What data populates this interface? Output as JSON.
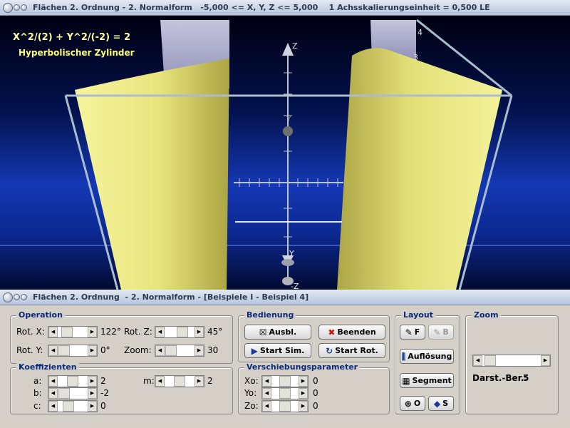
{
  "main_window": {
    "title": "Flächen 2. Ordnung - 2. Normalform   -5,000 <= X, Y, Z <= 5,000    1 Achsskalierungseinheit = 0,500 LE"
  },
  "scene": {
    "equation": "X^2/(2) + Y^2/(-2) = 2",
    "surface_name": "Hyperbolischer Zylinder",
    "axis_labels": {
      "z_top": "Z",
      "z_bottom": "-Z",
      "y_back": "Y",
      "y_front": "Y"
    },
    "corner_labels": {
      "four": "4",
      "three": "3"
    },
    "colors": {
      "surface": "#ecec7c",
      "background_dark": "#000012",
      "background_blue": "#1438b4",
      "frame": "#a8bece"
    }
  },
  "control_window": {
    "title": "Flächen 2. Ordnung  - 2. Normalform - [Beispiele I - Beispiel 4]"
  },
  "operation": {
    "title": "Operation",
    "rot_x": {
      "label": "Rot. X:",
      "value": "122°"
    },
    "rot_y": {
      "label": "Rot. Y:",
      "value": "0°"
    },
    "rot_z": {
      "label": "Rot. Z:",
      "value": "45°"
    },
    "zoom": {
      "label": "Zoom:",
      "value": "30"
    }
  },
  "koeffizienten": {
    "title": "Koeffizienten",
    "a": {
      "label": "a:",
      "value": "2"
    },
    "b": {
      "label": "b:",
      "value": "-2"
    },
    "c": {
      "label": "c:",
      "value": "0"
    },
    "m": {
      "label": "m:",
      "value": "2"
    }
  },
  "bedienung": {
    "title": "Bedienung",
    "ausbl": "Ausbl.",
    "beenden": "Beenden",
    "start_sim": "Start Sim.",
    "start_rot": "Start Rot."
  },
  "verschiebung": {
    "title": "Verschiebungsparameter",
    "xo": {
      "label": "Xo:",
      "value": "0"
    },
    "yo": {
      "label": "Yo:",
      "value": "0"
    },
    "zo": {
      "label": "Zo:",
      "value": "0"
    }
  },
  "layout": {
    "title": "Layout",
    "f": "F",
    "b": "B",
    "aufloesung": "Auflösung",
    "segment": "Segment",
    "o": "O",
    "s": "S"
  },
  "zoom_group": {
    "title": "Zoom",
    "darst_label": "Darst.-Ber.:",
    "darst_value": "5"
  }
}
